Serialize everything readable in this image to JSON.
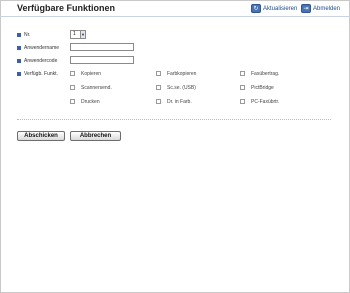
{
  "header": {
    "title": "Verfügbare Funktionen",
    "refresh_label": "Aktualisieren",
    "logout_label": "Abmelden"
  },
  "form": {
    "nr_label": "Nr.",
    "nr_value": "1",
    "app_name_label": "Anwendername",
    "app_code_label": "Anwendercode",
    "functions_label": "Verfügb. Funkt."
  },
  "functions": [
    {
      "label": "Kopieren"
    },
    {
      "label": "Farbkopieren"
    },
    {
      "label": "Faxübertrag."
    },
    {
      "label": "Scannersend."
    },
    {
      "label": "Sc.se. (USB)"
    },
    {
      "label": "PictBridge"
    },
    {
      "label": "Drucken"
    },
    {
      "label": "Dr. in Farb."
    },
    {
      "label": "PC-Faxübrtr."
    }
  ],
  "buttons": {
    "submit_label": "Abschicken",
    "cancel_label": "Abbrechen"
  }
}
